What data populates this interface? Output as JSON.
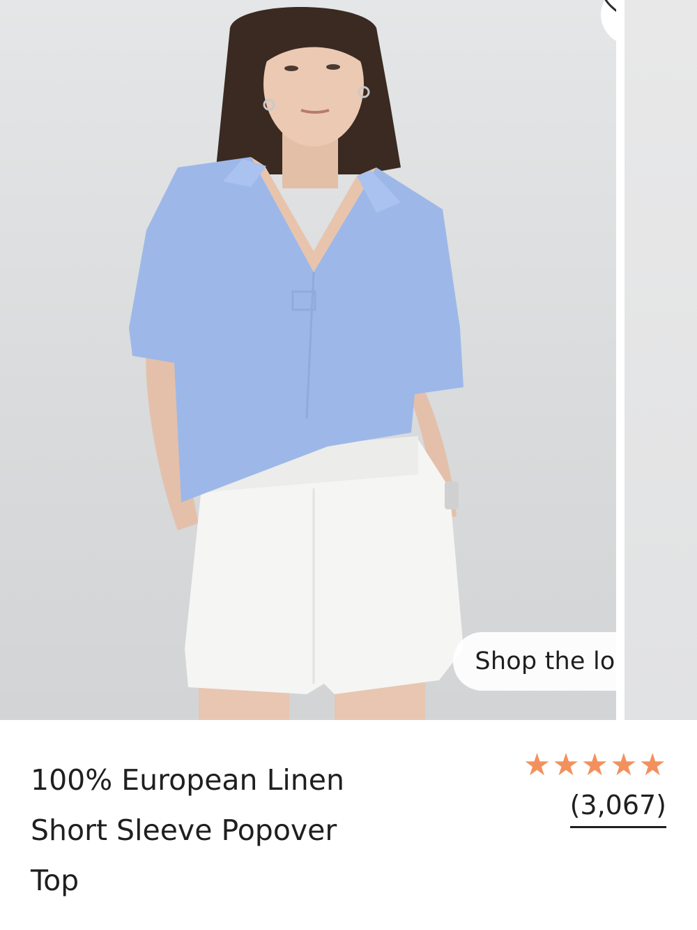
{
  "product": {
    "title_line1": "100% European Linen",
    "title_line2": "Short Sleeve Popover",
    "title_line3": "Top",
    "rating_stars": 5,
    "review_count": "(3,067)",
    "shop_the_look_label": "Shop the look"
  },
  "icons": {
    "favorite": "heart-outline-icon",
    "rating_star": "star-icon"
  },
  "colors": {
    "star": "#f2915e",
    "shirt": "#9db8e8",
    "shorts": "#f4f4f4",
    "background": "#dfe1e2"
  }
}
